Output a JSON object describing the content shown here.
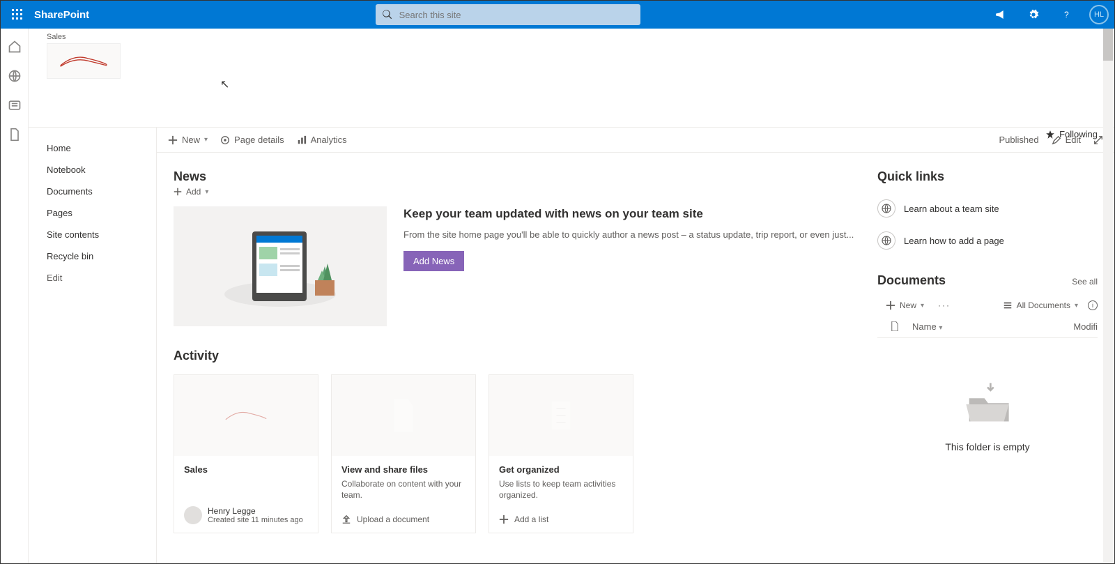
{
  "top": {
    "brand": "SharePoint",
    "search_placeholder": "Search this site",
    "avatar_initials": "HL"
  },
  "site": {
    "name": "Sales",
    "following_label": "Following"
  },
  "leftnav": {
    "items": [
      "Home",
      "Notebook",
      "Documents",
      "Pages",
      "Site contents",
      "Recycle bin",
      "Edit"
    ]
  },
  "cmdbar": {
    "new": "New",
    "page_details": "Page details",
    "analytics": "Analytics",
    "published": "Published",
    "edit": "Edit"
  },
  "news": {
    "heading": "News",
    "add": "Add",
    "title": "Keep your team updated with news on your team site",
    "desc": "From the site home page you'll be able to quickly author a news post – a status update, trip report, or even just...",
    "button": "Add News"
  },
  "activity": {
    "heading": "Activity",
    "cards": [
      {
        "title": "Sales",
        "desc": "",
        "person_name": "Henry Legge",
        "person_sub": "Created site 11 minutes ago",
        "action": ""
      },
      {
        "title": "View and share files",
        "desc": "Collaborate on content with your team.",
        "action": "Upload a document"
      },
      {
        "title": "Get organized",
        "desc": "Use lists to keep team activities organized.",
        "action": "Add a list"
      }
    ]
  },
  "quicklinks": {
    "heading": "Quick links",
    "items": [
      "Learn about a team site",
      "Learn how to add a page"
    ]
  },
  "documents": {
    "heading": "Documents",
    "see_all": "See all",
    "new": "New",
    "view_label": "All Documents",
    "col_name": "Name",
    "col_modified": "Modifi",
    "empty": "This folder is empty"
  }
}
